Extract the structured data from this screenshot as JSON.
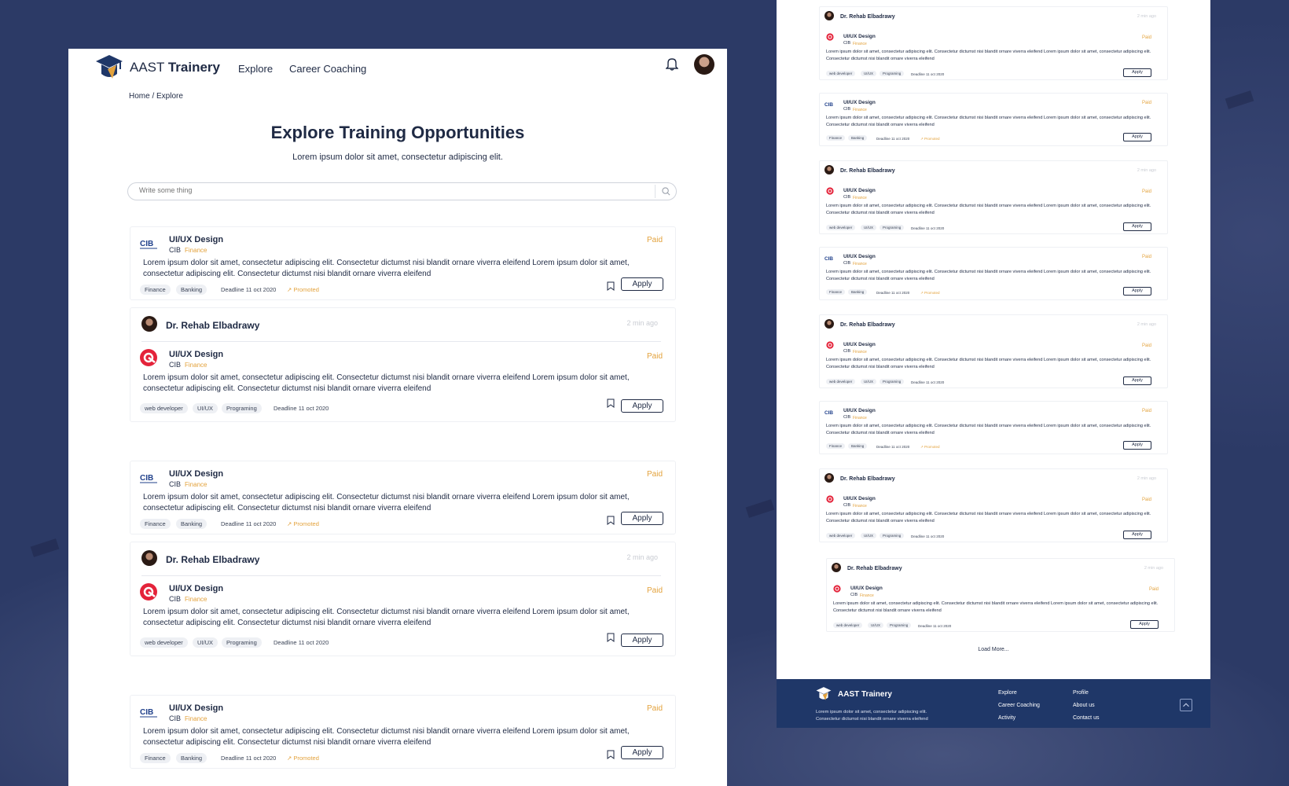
{
  "brand": {
    "name_light": "AAST ",
    "name_bold": "Trainery"
  },
  "nav": {
    "explore": "Explore",
    "career": "Career Coaching"
  },
  "breadcrumb": "Home / Explore",
  "hero": {
    "title": "Explore Training Opportunities",
    "subtitle": "Lorem ipsum dolor sit amet, consectetur adipiscing elit."
  },
  "search": {
    "placeholder": "Write some thing"
  },
  "common": {
    "title": "UI/UX Design",
    "company": "CIB",
    "category": "Finance",
    "paid": "Paid",
    "desc": "Lorem ipsum dolor sit amet, consectetur adipiscing elit. Consectetur dictumst nisi blandit ornare viverra eleifend Lorem ipsum dolor sit amet, consectetur adipiscing elit. Consectetur dictumst nisi blandit ornare viverra eleifend",
    "apply": "Apply",
    "deadline": "Deadline  11 oct 2020",
    "promoted": "Promoted",
    "poster": "Dr. Rehab Elbadrawy",
    "time": "2 min ago",
    "tags_a": [
      "Finance",
      "Banking"
    ],
    "tags_b": [
      "web developer",
      "UI/UX",
      "Programing"
    ]
  },
  "load_more": "Load More...",
  "footer": {
    "brand": "AAST Trainery",
    "desc": "Lorem ipsum dolor sit amet, consectetur adipiscing elit. Consectetur dictumst nisi blandit ornare viverra eleifend",
    "col1": [
      "Explore",
      "Career Coaching",
      "Activity"
    ],
    "col2": [
      "Profile",
      "About us",
      "Contact us"
    ]
  },
  "colors": {
    "navy": "#1f2a44",
    "accent": "#e3a23c",
    "footer": "#1f3768",
    "background": "#2c3a66"
  }
}
